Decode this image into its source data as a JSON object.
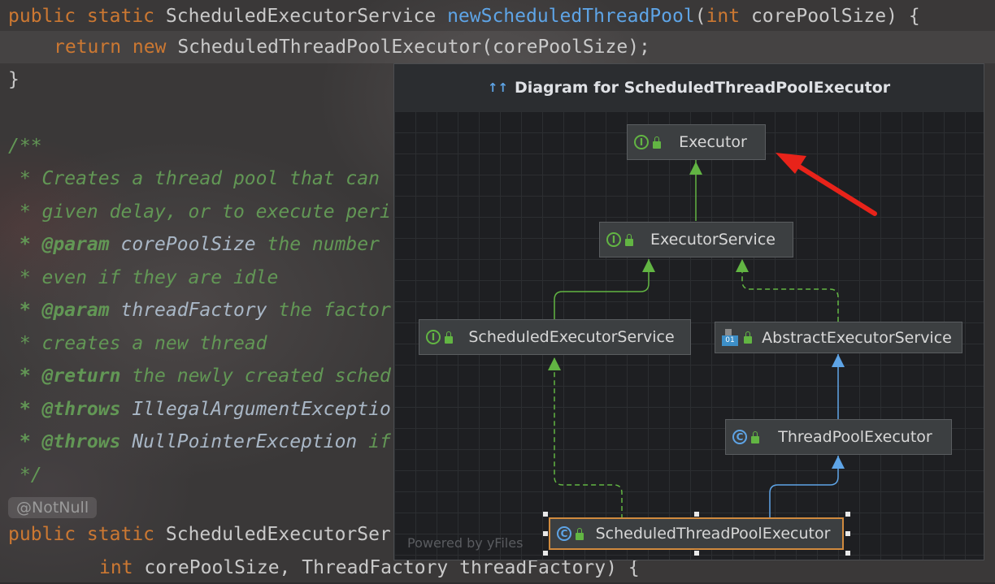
{
  "code": {
    "line1": {
      "kw1": "public static ",
      "type": "ScheduledExecutorService ",
      "fn": "newScheduledThreadPool",
      "params_open": "(",
      "kw_int": "int ",
      "params": "corePoolSize) {"
    },
    "line2": {
      "kw": "return new ",
      "text": "ScheduledThreadPoolExecutor(corePoolSize);"
    },
    "line3": "}",
    "c1": "/**",
    "c2": " * Creates a thread pool that can ",
    "c3": " * given delay, or to execute peri",
    "c4_tag": " * @param ",
    "c4_name": "corePoolSize",
    "c4_rest": " the number ",
    "c5": " * even if they are idle",
    "c6_tag": " * @param ",
    "c6_name": "threadFactory",
    "c6_rest": " the factor",
    "c7": " * creates a new thread",
    "c8_tag": " * @return",
    "c8_rest": " the newly created sched",
    "c9_tag": " * @throws ",
    "c9_name": "IllegalArgumentExceptio",
    "c10_tag": " * @throws ",
    "c10_name": "NullPointerException",
    "c10_rest": " if",
    "c11": " */",
    "annotation": "@NotNull",
    "line_last1": {
      "kw": "public static ",
      "text": "ScheduledExecutorSer"
    },
    "line_last2": {
      "kw": "int ",
      "text": "corePoolSize, ThreadFactory threadFactory) {"
    }
  },
  "diagram": {
    "title": "Diagram for ScheduledThreadPoolExecutor",
    "title_icon": "diagram-icon",
    "powered": "Powered by yFiles",
    "nodes": {
      "executor": {
        "label": "Executor",
        "kind": "I"
      },
      "executor_service": {
        "label": "ExecutorService",
        "kind": "I"
      },
      "scheduled_executor_service": {
        "label": "ScheduledExecutorService",
        "kind": "I"
      },
      "abstract_executor_service": {
        "label": "AbstractExecutorService",
        "kind": "abstract-class"
      },
      "thread_pool_executor": {
        "label": "ThreadPoolExecutor",
        "kind": "C"
      },
      "scheduled_thread_pool_executor": {
        "label": "ScheduledThreadPoolExecutor",
        "kind": "C"
      }
    },
    "colors": {
      "interface_edge": "#62b543",
      "class_edge": "#5ea4e6",
      "selection": "#d08a3e",
      "annotation_arrow": "#e8231a"
    }
  }
}
